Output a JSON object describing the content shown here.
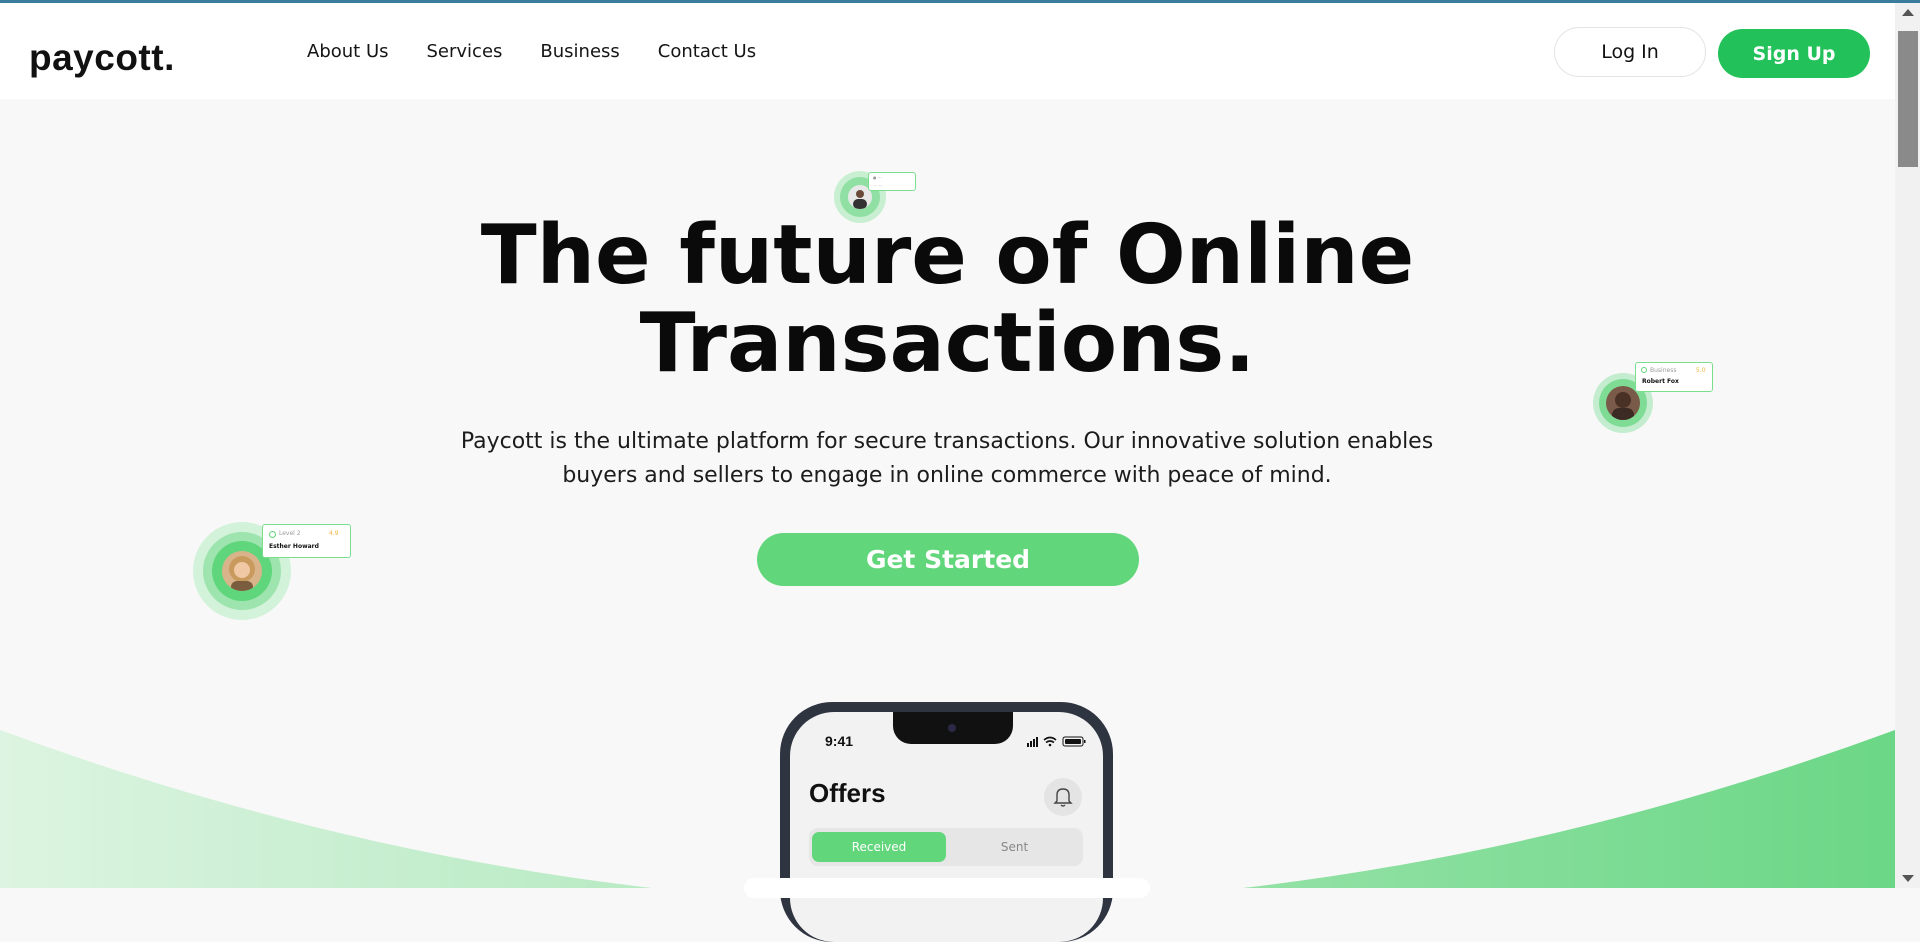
{
  "brand": {
    "logo": "paycott."
  },
  "nav": {
    "links": [
      "About Us",
      "Services",
      "Business",
      "Contact Us"
    ],
    "login_label": "Log In",
    "signup_label": "Sign Up"
  },
  "hero": {
    "title_line1": "The future of Online",
    "title_line2": "Transactions.",
    "subtitle_line1": "Paycott is the ultimate platform for secure transactions. Our innovative solution enables",
    "subtitle_line2": "buyers and sellers to engage in online commerce with peace of mind.",
    "cta_label": "Get Started"
  },
  "floating_profiles": [
    {
      "level": "Level 2",
      "name": "Esther Howard",
      "rating": "4.9"
    },
    {
      "level": "Business",
      "name": "Robert Fox",
      "rating": "5.0"
    }
  ],
  "phone": {
    "time": "9:41",
    "screen_title": "Offers",
    "tabs": [
      "Received",
      "Sent"
    ],
    "active_tab": "Received"
  },
  "colors": {
    "accent": "#22c15a",
    "cta": "#62d67b",
    "wave_light": "#d9f3df",
    "wave_dark": "#6fd98a"
  }
}
